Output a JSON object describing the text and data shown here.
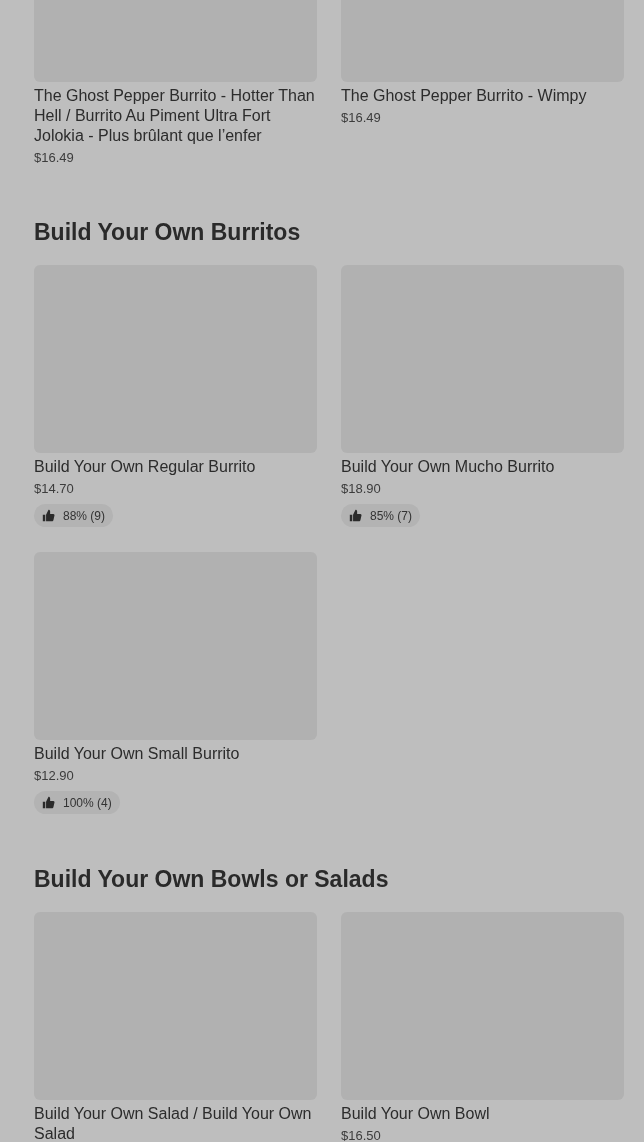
{
  "sections": [
    {
      "items": [
        {
          "name": "The Ghost Pepper Burrito - Hotter Than Hell / Burrito Au Piment Ultra Fort Jolokia - Plus brûlant que l’enfer",
          "price": "$16.49"
        },
        {
          "name": "The Ghost Pepper Burrito - Wimpy",
          "price": "$16.49"
        }
      ]
    },
    {
      "title": "Build Your Own Burritos",
      "items": [
        {
          "name": "Build Your Own Regular Burrito",
          "price": "$14.70",
          "rating": "88% (9)"
        },
        {
          "name": "Build Your Own Mucho Burrito",
          "price": "$18.90",
          "rating": "85% (7)"
        },
        {
          "name": "Build Your Own Small Burrito",
          "price": "$12.90",
          "rating": "100% (4)"
        }
      ]
    },
    {
      "title": "Build Your Own Bowls or Salads",
      "items": [
        {
          "name": "Build Your Own Salad / Build Your Own Salad"
        },
        {
          "name": "Build Your Own Bowl",
          "price": "$16.50"
        }
      ]
    }
  ]
}
